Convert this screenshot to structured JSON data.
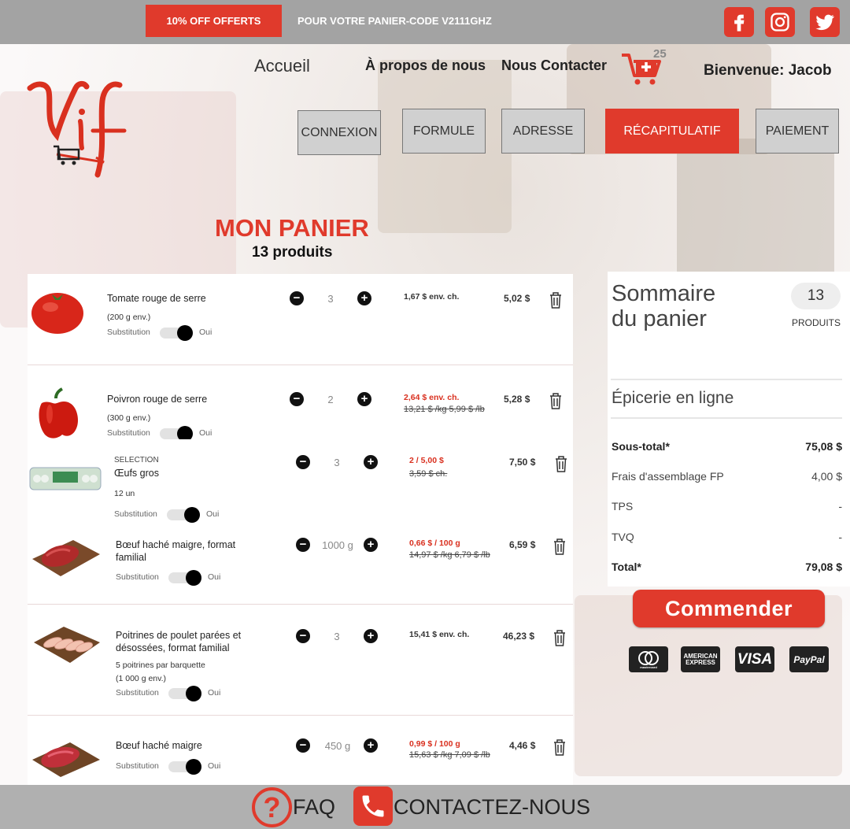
{
  "topbar": {
    "promo_badge": "10% OFF OFFERTS",
    "promo_text": "POUR VOTRE PANIER-CODE V2111GHZ",
    "social": [
      "facebook-icon",
      "instagram-icon",
      "twitter-icon"
    ]
  },
  "nav": {
    "home": "Accueil",
    "about": "À propos de nous",
    "contact": "Nous Contacter",
    "cart_count": "25",
    "welcome": "Bienvenue: Jacob"
  },
  "steps": [
    "CONNEXION",
    "FORMULE",
    "ADRESSE",
    "RÉCAPITULATIF",
    "PAIEMENT"
  ],
  "active_step": "RÉCAPITULATIF",
  "cart": {
    "title": "MON PANIER",
    "count_label": "13 produits"
  },
  "items": [
    {
      "name": "Tomate rouge de serre",
      "desc": "(200 g env.)",
      "substitution": "Substitution",
      "sub_value": "Oui",
      "qty": "3",
      "unit_price": "1,67 $ env. ch.",
      "total": "5,02 $"
    },
    {
      "name": "Poivron rouge de serre",
      "desc": "(300 g env.)",
      "substitution": "Substitution",
      "sub_value": "Oui",
      "qty": "2",
      "unit_price": "2,64 $ env. ch.",
      "old_price": "13,21 $ /kg 5,99 $ /lb",
      "total": "5,28 $"
    },
    {
      "category": "SELECTION",
      "name": "Œufs gros",
      "desc": "12 un",
      "substitution": "Substitution",
      "sub_value": "Oui",
      "qty": "3",
      "unit_price": "2 /  5,00 $",
      "old_price": "3,59 $  ch.",
      "total": "7,50 $"
    },
    {
      "name": "Bœuf haché maigre, format familial",
      "substitution": "Substitution",
      "sub_value": "Oui",
      "qty": "1000  g",
      "unit_price": "0,66 $ / 100 g",
      "old_price": "14,97 $ /kg 6,79 $ /lb",
      "total": "6,59 $"
    },
    {
      "name": "Poitrines de poulet parées et désossées, format familial",
      "desc": "5 poitrines par barquette",
      "desc2": "(1 000 g env.)",
      "substitution": "Substitution",
      "sub_value": "Oui",
      "qty": "3",
      "unit_price": "15,41 $ env. ch.",
      "total": "46,23 $"
    },
    {
      "name": "Bœuf haché maigre",
      "substitution": "Substitution",
      "sub_value": "Oui",
      "qty": "450  g",
      "unit_price": "0,99 $ / 100 g",
      "old_price": "15,63 $ /kg 7,09 $ /lb",
      "total": "4,46 $"
    }
  ],
  "summary": {
    "title_line1": "Sommaire",
    "title_line2": "du panier",
    "count": "13",
    "products_label": "PRODUITS",
    "section": "Épicerie en ligne",
    "rows": [
      {
        "label": "Sous-total*",
        "value": "75,08 $"
      },
      {
        "label": "Frais d'assemblage FP",
        "value": "4,00 $"
      },
      {
        "label": "TPS",
        "value": "-"
      },
      {
        "label": "TVQ",
        "value": "-"
      },
      {
        "label": "Total*",
        "value": "79,08 $"
      }
    ],
    "order_button": "Commender"
  },
  "payments": [
    "mastercard",
    "AMERICAN EXPRESS",
    "VISA",
    "PayPal"
  ],
  "footer": {
    "faq": "FAQ",
    "contact": "CONTACTEZ-NOUS"
  },
  "colors": {
    "accent": "#e03a2c",
    "topbar": "#a3a3a3",
    "footer": "#b0b0b0"
  }
}
